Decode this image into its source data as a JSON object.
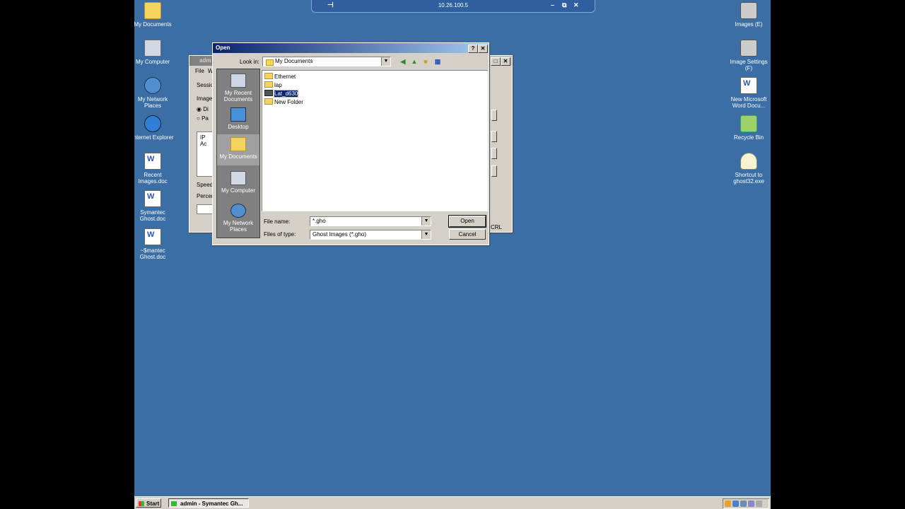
{
  "remote_bar": {
    "ip": "10.26.100.5",
    "pin": "⊣",
    "minimize": "–",
    "restore": "⧉",
    "close": "✕"
  },
  "desktop_icons_left": [
    {
      "label": "My Documents",
      "icon": "my-documents-icon"
    },
    {
      "label": "My Computer",
      "icon": "my-computer-icon"
    },
    {
      "label": "My Network Places",
      "icon": "network-places-icon"
    },
    {
      "label": "Internet Explorer",
      "icon": "internet-explorer-icon"
    },
    {
      "label": "Recent Images.doc",
      "icon": "word-doc-icon"
    },
    {
      "label": "Symantec Ghost.doc",
      "icon": "word-doc-icon"
    },
    {
      "label": "~$mantec Ghost.doc",
      "icon": "word-doc-icon"
    }
  ],
  "desktop_icons_right": [
    {
      "label": "Images (E)",
      "icon": "drive-icon"
    },
    {
      "label": "Image Settings (F)",
      "icon": "drive-icon"
    },
    {
      "label": "New Microsoft Word Docu...",
      "icon": "word-doc-icon"
    },
    {
      "label": "Recycle Bin",
      "icon": "recycle-bin-icon"
    },
    {
      "label": "Shortcut to ghost32.exe",
      "icon": "ghost-icon"
    }
  ],
  "bg_window": {
    "title": "adm",
    "menu_file": "File",
    "menu_w": "W",
    "session_label": "Sessio",
    "image_label": "Image",
    "radio1": "Di",
    "radio2": "Pa",
    "ip_header": "IP Ac",
    "speed_label": "Speed",
    "percent_label": "Percen",
    "crl_label": "CRL"
  },
  "dialog": {
    "title": "Open",
    "help_button": "?",
    "close_button": "✕",
    "look_in_label": "Look in:",
    "look_in_value": "My Documents",
    "places": [
      {
        "label": "My Recent Documents"
      },
      {
        "label": "Desktop"
      },
      {
        "label": "My Documents"
      },
      {
        "label": "My Computer"
      },
      {
        "label": "My Network Places"
      }
    ],
    "files": [
      {
        "name": "Ethernet"
      },
      {
        "name": "lap"
      },
      {
        "name": "Lat_d630"
      },
      {
        "name": "New Folder"
      }
    ],
    "file_name_label": "File name:",
    "file_name_value": "*.gho",
    "file_type_label": "Files of type:",
    "file_type_value": "Ghost Images (*.gho)",
    "open_button": "Open",
    "cancel_button": "Cancel"
  },
  "taskbar": {
    "start_label": "Start",
    "task_label": "admin - Symantec Gh..."
  },
  "colors": {
    "desktop": "#3a6ea5",
    "title_active": "#0a246a",
    "face": "#d4d0c8"
  }
}
